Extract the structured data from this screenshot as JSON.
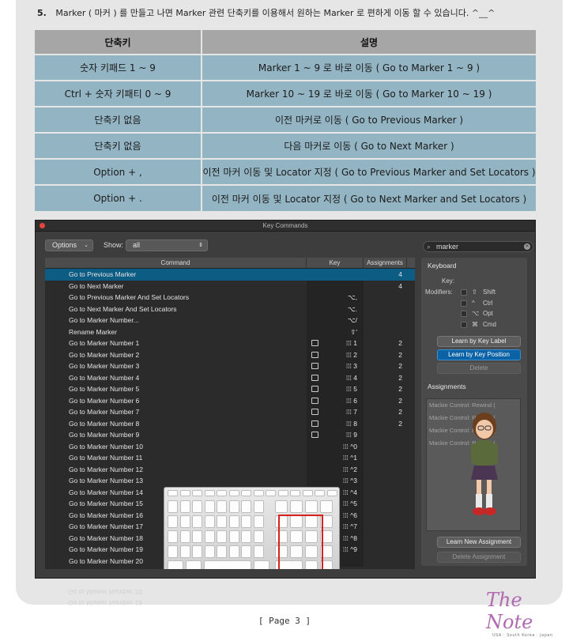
{
  "heading": {
    "number": "5.",
    "text": "Marker ( 마커 ) 를 만들고 나면 Marker 관련 단축키를 이용해서 원하는 Marker 로 편하게 이동 할 수 있습니다.",
    "tail": "^__^"
  },
  "shortcut_table": {
    "headers": [
      "단축키",
      "설명"
    ],
    "rows": [
      [
        "숫자 키패드 1 ~ 9",
        "Marker 1 ~ 9 로 바로 이동 ( Go to Marker 1 ~ 9 )"
      ],
      [
        "Ctrl + 숫자 키패티 0 ~ 9",
        "Marker 10 ~ 19 로 바로 이동 ( Go to Marker 10 ~ 19 )"
      ],
      [
        "단축키 없음",
        "이전 마커로 이동 ( Go to Previous Marker )"
      ],
      [
        "단축키 없음",
        "다음 마커로 이동 ( Go to Next Marker )"
      ],
      [
        "Option + ,",
        "이전 마커 이동 및 Locator 지정 ( Go to Previous Marker and Set Locators )"
      ],
      [
        "Option + .",
        "이전 마커 이동 및 Locator 지정 ( Go to Next Marker and Set Locators )"
      ]
    ]
  },
  "key_commands": {
    "window_title": "Key Commands",
    "options_label": "Options",
    "show_label": "Show:",
    "show_value": "all",
    "search_value": "marker",
    "columns": [
      "Command",
      "Key",
      "Assignments"
    ],
    "rows": [
      {
        "command": "Go to Previous Marker",
        "key": "",
        "assign": "4",
        "kb": false
      },
      {
        "command": "Go to Next Marker",
        "key": "",
        "assign": "4",
        "kb": false
      },
      {
        "command": "Go to Previous Marker And Set Locators",
        "key": "⌥,",
        "assign": "",
        "kb": false
      },
      {
        "command": "Go to Next Marker And Set Locators",
        "key": "⌥.",
        "assign": "",
        "kb": false
      },
      {
        "command": "Go to Marker Number...",
        "key": "⌥/",
        "assign": "",
        "kb": false
      },
      {
        "command": "Rename Marker",
        "key": "⇧'",
        "assign": "",
        "kb": false
      },
      {
        "command": "Go to Marker Number 1",
        "key": "⁞⁞⁞ 1",
        "assign": "2",
        "kb": true
      },
      {
        "command": "Go to Marker Number 2",
        "key": "⁞⁞⁞ 2",
        "assign": "2",
        "kb": true
      },
      {
        "command": "Go to Marker Number 3",
        "key": "⁞⁞⁞ 3",
        "assign": "2",
        "kb": true
      },
      {
        "command": "Go to Marker Number 4",
        "key": "⁞⁞⁞ 4",
        "assign": "2",
        "kb": true
      },
      {
        "command": "Go to Marker Number 5",
        "key": "⁞⁞⁞ 5",
        "assign": "2",
        "kb": true
      },
      {
        "command": "Go to Marker Number 6",
        "key": "⁞⁞⁞ 6",
        "assign": "2",
        "kb": true
      },
      {
        "command": "Go to Marker Number 7",
        "key": "⁞⁞⁞ 7",
        "assign": "2",
        "kb": true
      },
      {
        "command": "Go to Marker Number 8",
        "key": "⁞⁞⁞ 8",
        "assign": "2",
        "kb": true
      },
      {
        "command": "Go to Marker Number 9",
        "key": "⁞⁞⁞ 9",
        "assign": "",
        "kb": true
      },
      {
        "command": "Go to Marker Number 10",
        "key": "⁞⁞⁞ ^0",
        "assign": "",
        "kb": false
      },
      {
        "command": "Go to Marker Number 11",
        "key": "⁞⁞⁞ ^1",
        "assign": "",
        "kb": false
      },
      {
        "command": "Go to Marker Number 12",
        "key": "⁞⁞⁞ ^2",
        "assign": "",
        "kb": false
      },
      {
        "command": "Go to Marker Number 13",
        "key": "⁞⁞⁞ ^3",
        "assign": "",
        "kb": false
      },
      {
        "command": "Go to Marker Number 14",
        "key": "⁞⁞⁞ ^4",
        "assign": "",
        "kb": false
      },
      {
        "command": "Go to Marker Number 15",
        "key": "⁞⁞⁞ ^5",
        "assign": "",
        "kb": false
      },
      {
        "command": "Go to Marker Number 16",
        "key": "⁞⁞⁞ ^6",
        "assign": "",
        "kb": false
      },
      {
        "command": "Go to Marker Number 17",
        "key": "⁞⁞⁞ ^7",
        "assign": "",
        "kb": false
      },
      {
        "command": "Go to Marker Number 18",
        "key": "⁞⁞⁞ ^8",
        "assign": "",
        "kb": false
      },
      {
        "command": "Go to Marker Number 19",
        "key": "⁞⁞⁞ ^9",
        "assign": "",
        "kb": false
      },
      {
        "command": "Go to Marker Number 20",
        "key": "",
        "assign": "",
        "kb": false
      }
    ],
    "panel": {
      "keyboard_title": "Keyboard",
      "key_label": "Key:",
      "modifiers_label": "Modifiers:",
      "modifiers": [
        {
          "symbol": "⇧",
          "name": "Shift"
        },
        {
          "symbol": "^",
          "name": "Ctrl"
        },
        {
          "symbol": "⌥",
          "name": "Opt"
        },
        {
          "symbol": "⌘",
          "name": "Cmd"
        }
      ],
      "learn_by_label": "Learn by Key Label",
      "learn_by_position": "Learn by Key Position",
      "delete": "Delete",
      "assignments_title": "Assignments",
      "assignments": [
        "Mackie Control: Rewind (",
        "Mackie Control: Rewind (",
        "Mackie Control: Rewind (",
        "Mackie Control: Rewind ("
      ],
      "learn_new": "Learn New Assignment",
      "delete_assignment": "Delete Assignment"
    }
  },
  "reflection": [
    "Go to Marker Number 20",
    "Go to Marker Number 19"
  ],
  "footer": {
    "page": "[ Page 3 ]",
    "logo": "The Note",
    "logo_sub": "USA · South Korea · Japan"
  }
}
